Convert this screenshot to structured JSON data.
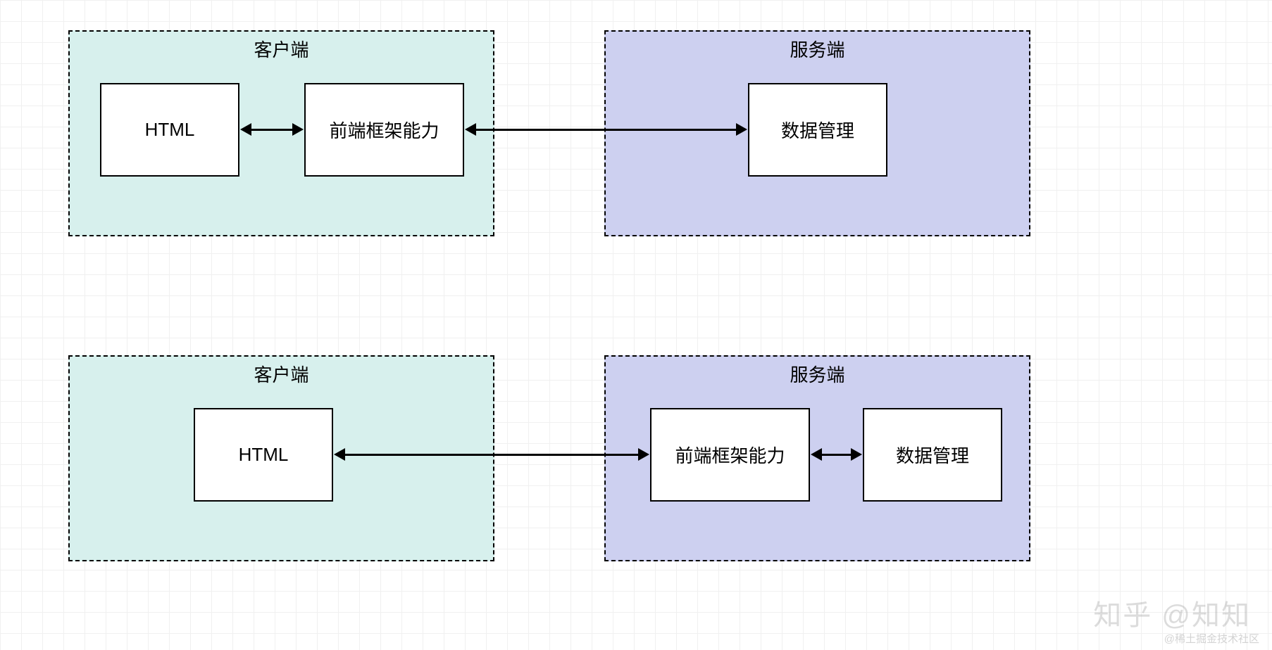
{
  "diagram1": {
    "client": {
      "title": "客户端",
      "nodes": {
        "html": "HTML",
        "frontend": "前端框架能力"
      }
    },
    "server": {
      "title": "服务端",
      "nodes": {
        "data": "数据管理"
      }
    }
  },
  "diagram2": {
    "client": {
      "title": "客户端",
      "nodes": {
        "html": "HTML"
      }
    },
    "server": {
      "title": "服务端",
      "nodes": {
        "frontend": "前端框架能力",
        "data": "数据管理"
      }
    }
  },
  "watermark": {
    "main": "知乎 @知知",
    "sub": "@稀土掘金技术社区"
  },
  "colors": {
    "client_bg": "#d7f0ed",
    "server_bg": "#cdd0f0",
    "grid": "#f0f0f0",
    "stroke": "#000000"
  }
}
